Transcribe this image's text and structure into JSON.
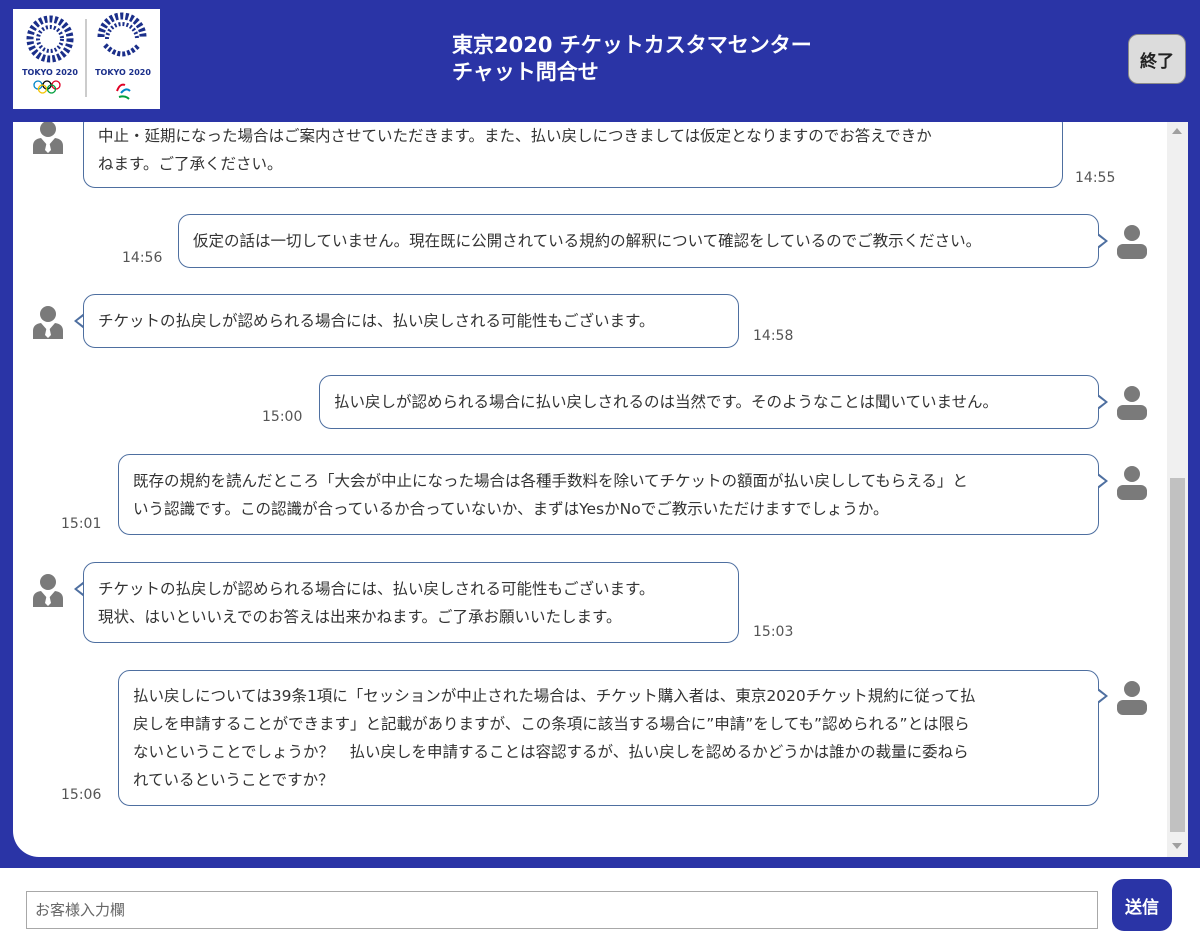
{
  "header": {
    "logo_olympic_text": "TOKYO 2020",
    "logo_paralympic_text": "TOKYO 2020",
    "title_line1": "東京2020 チケットカスタマセンター",
    "title_line2": "チャット問合せ",
    "end_button": "終了"
  },
  "messages": [
    {
      "sender": "agent",
      "lines": [
        "中止・延期になった場合はご案内させていただきます。また、払い戻しにつきましては仮定となりますのでお答えできか",
        "ねます。ご了承ください。"
      ],
      "time": "14:55"
    },
    {
      "sender": "user",
      "lines": [
        "仮定の話は一切していません。現在既に公開されている規約の解釈について確認をしているのでご教示ください。"
      ],
      "time": "14:56"
    },
    {
      "sender": "agent",
      "lines": [
        "チケットの払戻しが認められる場合には、払い戻しされる可能性もございます。"
      ],
      "time": "14:58"
    },
    {
      "sender": "user",
      "lines": [
        "払い戻しが認められる場合に払い戻しされるのは当然です。そのようなことは聞いていません。"
      ],
      "time": "15:00"
    },
    {
      "sender": "user",
      "lines": [
        "既存の規約を読んだところ「大会が中止になった場合は各種手数料を除いてチケットの額面が払い戻ししてもらえる」と",
        "いう認識です。この認識が合っているか合っていないか、まずはYesかNoでご教示いただけますでしょうか。"
      ],
      "time": "15:01"
    },
    {
      "sender": "agent",
      "lines": [
        "チケットの払戻しが認められる場合には、払い戻しされる可能性もございます。",
        "現状、はいといいえでのお答えは出来かねます。ご了承お願いいたします。"
      ],
      "time": "15:03"
    },
    {
      "sender": "user",
      "lines": [
        "払い戻しについては39条1項に「セッションが中止された場合は、チケット購入者は、東京2020チケット規約に従って払",
        "戻しを申請することができます」と記載がありますが、この条項に該当する場合に”申請”をしても”認められる”とは限ら",
        "ないということでしょうか？　払い戻しを申請することは容認するが、払い戻しを認めるかどうかは誰かの裁量に委ねら",
        "れているということですか？"
      ],
      "time": "15:06"
    }
  ],
  "input": {
    "placeholder": "お客様入力欄",
    "value": ""
  },
  "send_button": "送信",
  "colors": {
    "brand": "#2a34a6",
    "bubble_border": "#4e6fa0",
    "avatar": "#7a7a7a"
  }
}
